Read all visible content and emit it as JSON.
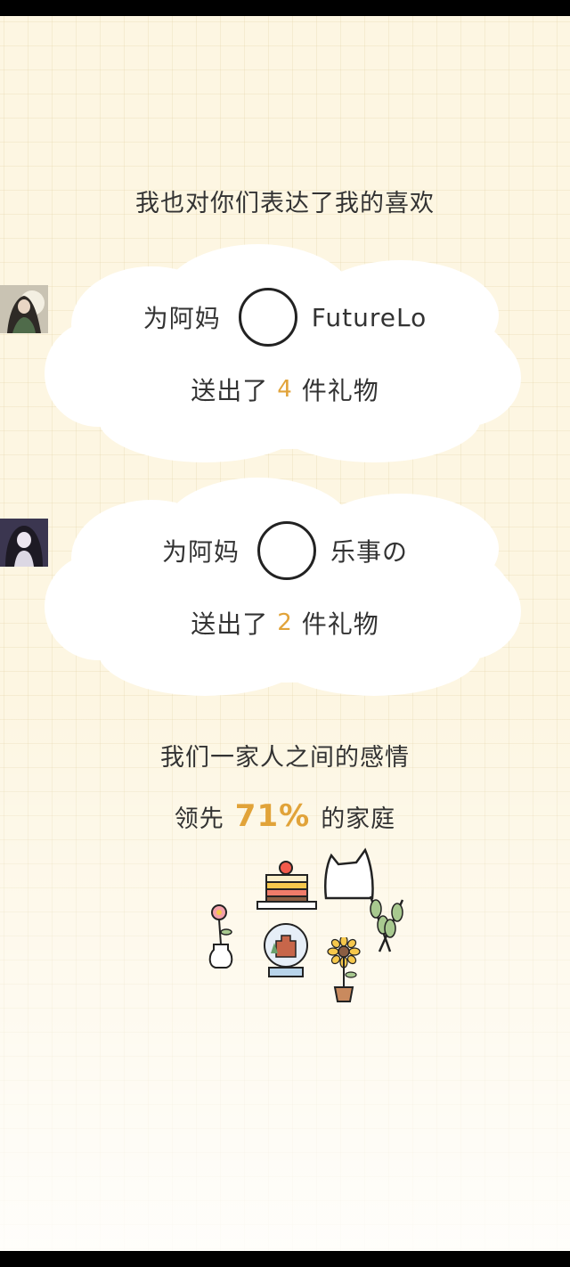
{
  "title": "我也对你们表达了我的喜欢",
  "gift_cards": [
    {
      "prefix": "为阿妈",
      "user": "FutureLo",
      "sent_label": "送出了",
      "count": "4",
      "unit_label": "件礼物",
      "avatar_icon": "anime-avatar-icon"
    },
    {
      "prefix": "为阿妈",
      "user": "乐事の",
      "sent_label": "送出了",
      "count": "2",
      "unit_label": "件礼物",
      "avatar_icon": "anime-avatar-icon"
    }
  ],
  "family": {
    "line1": "我们一家人之间的感情",
    "lead_label": "领先",
    "percent": "71%",
    "trail_label": "的家庭"
  },
  "decorations": [
    "cake-icon",
    "cat-icon",
    "flower-vase-icon",
    "snow-globe-icon",
    "sunflower-icon",
    "leaves-icon"
  ],
  "colors": {
    "accent": "#e1a339",
    "text": "#333333",
    "background": "#fdf6e2"
  }
}
